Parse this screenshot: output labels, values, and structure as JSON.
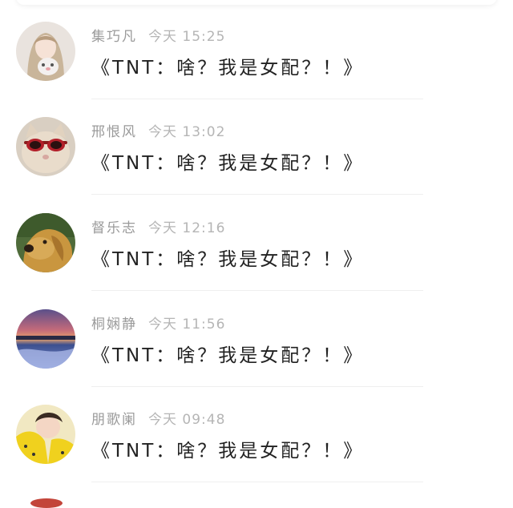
{
  "comments": [
    {
      "name": "集巧凡",
      "time": "今天 15:25",
      "text": "《TNT：啥？我是女配？！》",
      "avatar": "girl-holding-plush-avatar"
    },
    {
      "name": "邢恨风",
      "time": "今天 13:02",
      "text": "《TNT：啥？我是女配？！》",
      "avatar": "cat-with-sunglasses-avatar"
    },
    {
      "name": "督乐志",
      "time": "今天 12:16",
      "text": "《TNT：啥？我是女配？！》",
      "avatar": "golden-retriever-avatar"
    },
    {
      "name": "桐娴静",
      "time": "今天 11:56",
      "text": "《TNT：啥？我是女配？！》",
      "avatar": "sunset-landscape-avatar"
    },
    {
      "name": "朋歌阑",
      "time": "今天 09:48",
      "text": "《TNT：啥？我是女配？！》",
      "avatar": "person-yellow-outfit-avatar"
    }
  ],
  "colors": {
    "name": "#9a9a9a",
    "time": "#b5b5b5",
    "message": "#222222",
    "divider": "#efefef"
  }
}
